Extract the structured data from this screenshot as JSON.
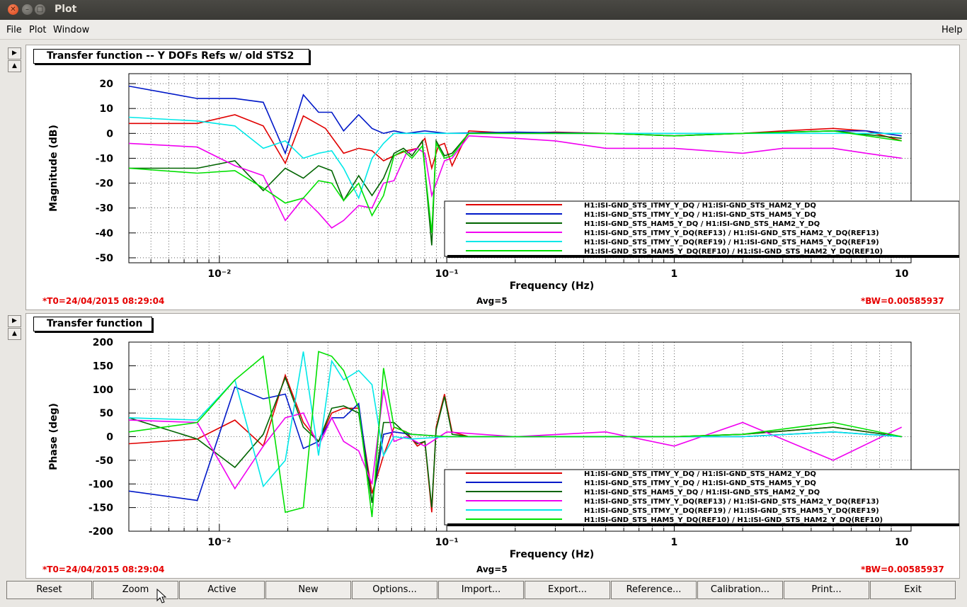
{
  "window": {
    "title": "Plot"
  },
  "menu": {
    "file": "File",
    "plot": "Plot",
    "window": "Window",
    "help": "Help"
  },
  "series_colors": [
    "#e00000",
    "#0018c8",
    "#006400",
    "#f000f0",
    "#00e8e8",
    "#00e000"
  ],
  "panels": [
    {
      "title": "Transfer function -- Y DOFs Refs w/ old STS2",
      "t0": "*T0=24/04/2015 08:29:04",
      "avg": "Avg=5",
      "bw": "*BW=0.00585937"
    },
    {
      "title": "Transfer function",
      "t0": "*T0=24/04/2015 08:29:04",
      "avg": "Avg=5",
      "bw": "*BW=0.00585937"
    }
  ],
  "buttons": [
    "Reset",
    "Zoom",
    "Active",
    "New",
    "Options...",
    "Import...",
    "Export...",
    "Reference...",
    "Calibration...",
    "Print...",
    "Exit"
  ],
  "chart_data": [
    {
      "type": "line",
      "title": "Transfer function -- Y DOFs Refs w/ old STS2",
      "xlabel": "Frequency (Hz)",
      "ylabel": "Magnitude (dB)",
      "xscale": "log",
      "xlim": [
        0.004,
        11
      ],
      "ylim": [
        -52,
        24
      ],
      "xticks": [
        "10⁻²",
        "10⁻¹",
        "1",
        "10"
      ],
      "yticks": [
        -50,
        -40,
        -30,
        -20,
        -10,
        0,
        10,
        20
      ],
      "grid": true,
      "legend": "bottom-right",
      "series": [
        {
          "name": "H1:ISI-GND_STS_ITMY_Y_DQ / H1:ISI-GND_STS_HAM2_Y_DQ",
          "x": [
            0.004,
            0.008,
            0.0117,
            0.0156,
            0.0195,
            0.0234,
            0.0293,
            0.0352,
            0.041,
            0.0469,
            0.0527,
            0.0586,
            0.0664,
            0.0742,
            0.0801,
            0.0859,
            0.0918,
            0.0977,
            0.1055,
            0.125,
            0.2,
            0.3,
            0.5,
            1,
            2,
            3,
            5,
            7,
            10
          ],
          "y": [
            4,
            4,
            7.5,
            3,
            -12,
            7,
            2,
            -8,
            -6,
            -7,
            -11,
            -9,
            -7,
            -6,
            -2,
            -14,
            -5,
            -4,
            -13,
            1,
            0,
            0.5,
            0,
            -1,
            0,
            1,
            2,
            1,
            -3
          ]
        },
        {
          "name": "H1:ISI-GND_STS_ITMY_Y_DQ / H1:ISI-GND_STS_HAM5_Y_DQ",
          "x": [
            0.004,
            0.008,
            0.0117,
            0.0156,
            0.0195,
            0.0234,
            0.0273,
            0.0312,
            0.0352,
            0.041,
            0.0469,
            0.0527,
            0.0586,
            0.0664,
            0.08,
            0.1,
            0.2,
            0.5,
            1,
            2,
            3,
            5,
            7,
            10
          ],
          "y": [
            19,
            14,
            14,
            12.5,
            -8,
            15.5,
            8.5,
            8.5,
            1,
            7.5,
            2,
            0,
            1,
            0,
            1,
            0,
            0.5,
            0,
            0,
            0,
            0.5,
            1,
            1,
            -1
          ]
        },
        {
          "name": "H1:ISI-GND_STS_HAM5_Y_DQ / H1:ISI-GND_STS_HAM2_Y_DQ",
          "x": [
            0.004,
            0.008,
            0.0117,
            0.0156,
            0.0195,
            0.0234,
            0.0273,
            0.0312,
            0.0352,
            0.041,
            0.0469,
            0.0527,
            0.0586,
            0.0645,
            0.0703,
            0.0781,
            0.0859,
            0.0898,
            0.0977,
            0.1055,
            0.125,
            0.2,
            0.5,
            1,
            2,
            5,
            10
          ],
          "y": [
            -14,
            -14,
            -11,
            -23,
            -14,
            -18,
            -13,
            -15,
            -27,
            -17,
            -25,
            -18,
            -8,
            -6,
            -9,
            -3,
            -45,
            -3,
            -9,
            -8,
            0,
            0,
            0,
            -1,
            0,
            1,
            -2
          ]
        },
        {
          "name": "H1:ISI-GND_STS_ITMY_Y_DQ(REF13) / H1:ISI-GND_STS_HAM2_Y_DQ(REF13)",
          "x": [
            0.004,
            0.008,
            0.0117,
            0.0156,
            0.0195,
            0.0234,
            0.0273,
            0.0312,
            0.0352,
            0.041,
            0.0469,
            0.0527,
            0.0586,
            0.0664,
            0.0742,
            0.0801,
            0.0859,
            0.0977,
            0.1055,
            0.125,
            0.2,
            0.3,
            0.5,
            1,
            2,
            3,
            5,
            7,
            10
          ],
          "y": [
            -4,
            -5.5,
            -13,
            -17,
            -35,
            -26,
            -32,
            -38,
            -35,
            -29,
            -30,
            -20,
            -19,
            -8,
            -6,
            -8,
            -25,
            -11,
            -10,
            -1,
            -2,
            -3,
            -6,
            -6,
            -8,
            -6,
            -6,
            -8,
            -10
          ]
        },
        {
          "name": "H1:ISI-GND_STS_ITMY_Y_DQ(REF19) / H1:ISI-GND_STS_HAM5_Y_DQ(REF19)",
          "x": [
            0.004,
            0.008,
            0.0117,
            0.0156,
            0.0195,
            0.0234,
            0.0273,
            0.0312,
            0.0352,
            0.041,
            0.0469,
            0.0527,
            0.0586,
            0.07,
            0.1,
            0.2,
            0.5,
            1,
            2,
            5,
            10
          ],
          "y": [
            6.5,
            5,
            3,
            -6,
            -3,
            -10,
            -8,
            -7,
            -14,
            -26,
            -10,
            -4,
            0,
            0,
            0,
            0,
            0,
            0,
            0,
            0,
            0
          ]
        },
        {
          "name": "H1:ISI-GND_STS_HAM5_Y_DQ(REF10) / H1:ISI-GND_STS_HAM2_Y_DQ(REF10)",
          "x": [
            0.004,
            0.008,
            0.0117,
            0.0156,
            0.0195,
            0.0234,
            0.0273,
            0.0312,
            0.0352,
            0.041,
            0.0469,
            0.0527,
            0.0586,
            0.0645,
            0.0703,
            0.0781,
            0.0859,
            0.0898,
            0.0977,
            0.1055,
            0.125,
            0.2,
            0.5,
            1,
            2,
            5,
            10
          ],
          "y": [
            -14,
            -16,
            -15,
            -22,
            -28,
            -26,
            -19,
            -20,
            -27,
            -20,
            -33,
            -25,
            -9,
            -7,
            -10,
            -5,
            -40,
            -4,
            -10,
            -9,
            0,
            0,
            0,
            -1,
            0,
            1,
            -3
          ]
        }
      ]
    },
    {
      "type": "line",
      "title": "Transfer function",
      "xlabel": "Frequency (Hz)",
      "ylabel": "Phase (deg)",
      "xscale": "log",
      "xlim": [
        0.004,
        11
      ],
      "ylim": [
        -200,
        200
      ],
      "xticks": [
        "10⁻²",
        "10⁻¹",
        "1",
        "10"
      ],
      "yticks": [
        -200,
        -150,
        -100,
        -50,
        0,
        50,
        100,
        150,
        200
      ],
      "grid": true,
      "legend": "bottom-right",
      "series": [
        {
          "name": "H1:ISI-GND_STS_ITMY_Y_DQ / H1:ISI-GND_STS_HAM2_Y_DQ",
          "x": [
            0.004,
            0.008,
            0.0117,
            0.0156,
            0.0195,
            0.0234,
            0.0273,
            0.0312,
            0.0352,
            0.041,
            0.0469,
            0.0527,
            0.0586,
            0.0664,
            0.0742,
            0.0801,
            0.0859,
            0.0898,
            0.0977,
            0.1055,
            0.125,
            0.2,
            0.5,
            1,
            2,
            5,
            10
          ],
          "y": [
            -15,
            -5,
            35,
            -20,
            130,
            30,
            -10,
            50,
            60,
            60,
            -120,
            -40,
            20,
            10,
            -20,
            -10,
            -160,
            20,
            90,
            10,
            0,
            0,
            0,
            0,
            5,
            20,
            0
          ]
        },
        {
          "name": "H1:ISI-GND_STS_ITMY_Y_DQ / H1:ISI-GND_STS_HAM5_Y_DQ",
          "x": [
            0.004,
            0.008,
            0.0117,
            0.0156,
            0.0195,
            0.0234,
            0.0273,
            0.0312,
            0.0352,
            0.041,
            0.0469,
            0.0527,
            0.0586,
            0.07,
            0.1,
            0.2,
            0.5,
            1,
            2,
            5,
            10
          ],
          "y": [
            -115,
            -135,
            105,
            80,
            90,
            -25,
            -10,
            40,
            40,
            70,
            -140,
            5,
            10,
            5,
            0,
            0,
            0,
            0,
            0,
            10,
            0
          ]
        },
        {
          "name": "H1:ISI-GND_STS_HAM5_Y_DQ / H1:ISI-GND_STS_HAM2_Y_DQ",
          "x": [
            0.004,
            0.008,
            0.0117,
            0.0156,
            0.0195,
            0.0234,
            0.0273,
            0.0312,
            0.0352,
            0.041,
            0.0469,
            0.0527,
            0.0586,
            0.0664,
            0.0742,
            0.0801,
            0.0859,
            0.0898,
            0.0977,
            0.1055,
            0.125,
            0.2,
            0.5,
            1,
            2,
            5,
            10
          ],
          "y": [
            40,
            -5,
            -65,
            5,
            125,
            20,
            -10,
            60,
            65,
            50,
            -140,
            30,
            30,
            5,
            -15,
            -10,
            -150,
            15,
            85,
            5,
            0,
            0,
            0,
            0,
            5,
            20,
            0
          ]
        },
        {
          "name": "H1:ISI-GND_STS_ITMY_Y_DQ(REF13) / H1:ISI-GND_STS_HAM2_Y_DQ(REF13)",
          "x": [
            0.004,
            0.008,
            0.0117,
            0.0156,
            0.0195,
            0.0234,
            0.0273,
            0.0312,
            0.0352,
            0.041,
            0.0469,
            0.0527,
            0.0586,
            0.0664,
            0.08,
            0.1,
            0.2,
            0.5,
            1,
            2,
            5,
            10
          ],
          "y": [
            35,
            30,
            -110,
            -20,
            40,
            50,
            -20,
            40,
            -10,
            -30,
            -100,
            100,
            -10,
            0,
            -20,
            10,
            0,
            10,
            -20,
            30,
            -50,
            20
          ]
        },
        {
          "name": "H1:ISI-GND_STS_ITMY_Y_DQ(REF19) / H1:ISI-GND_STS_HAM5_Y_DQ(REF19)",
          "x": [
            0.004,
            0.008,
            0.0117,
            0.0156,
            0.0195,
            0.0234,
            0.0273,
            0.0312,
            0.0352,
            0.041,
            0.0469,
            0.0527,
            0.0586,
            0.07,
            0.1,
            0.2,
            0.5,
            1,
            2,
            5,
            10
          ],
          "y": [
            40,
            35,
            120,
            -105,
            -50,
            180,
            -40,
            160,
            120,
            140,
            110,
            -40,
            0,
            -5,
            0,
            0,
            0,
            0,
            0,
            10,
            0
          ]
        },
        {
          "name": "H1:ISI-GND_STS_HAM5_Y_DQ(REF10) / H1:ISI-GND_STS_HAM2_Y_DQ(REF10)",
          "x": [
            0.004,
            0.008,
            0.0117,
            0.0156,
            0.0195,
            0.0234,
            0.0273,
            0.0312,
            0.0352,
            0.041,
            0.0469,
            0.0527,
            0.0586,
            0.07,
            0.1,
            0.2,
            0.5,
            1,
            2,
            5,
            10
          ],
          "y": [
            10,
            30,
            120,
            170,
            -160,
            -150,
            180,
            170,
            140,
            60,
            -170,
            145,
            20,
            5,
            0,
            0,
            0,
            0,
            5,
            30,
            0
          ]
        }
      ]
    }
  ]
}
